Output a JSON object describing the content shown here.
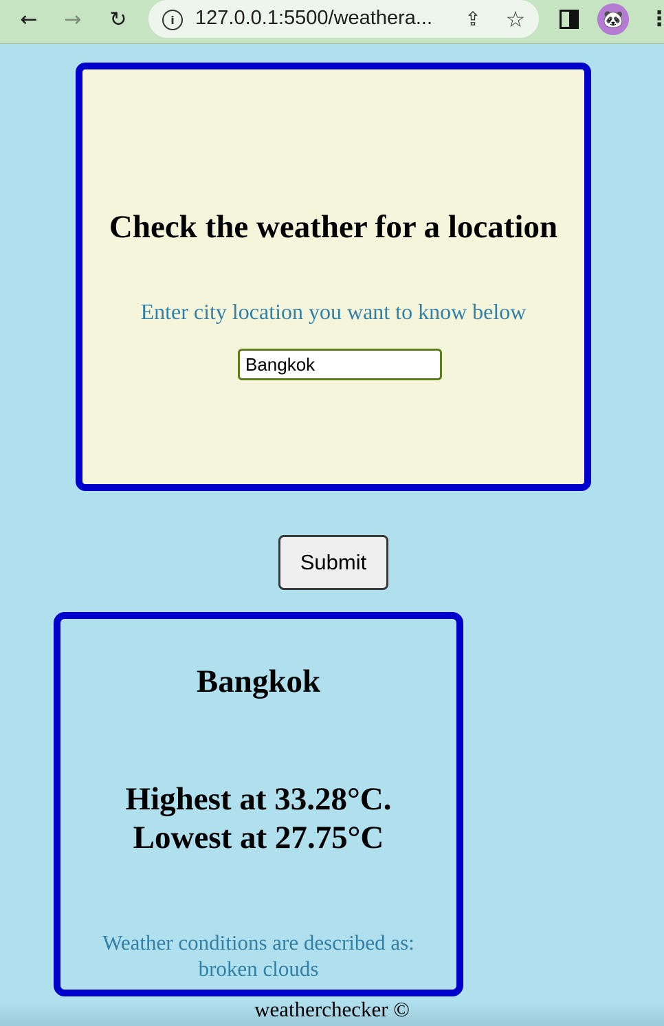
{
  "browser": {
    "url": "127.0.0.1:5500/weathera...",
    "icons": [
      "back-arrow-icon",
      "forward-arrow-icon",
      "reload-icon",
      "info-icon",
      "share-icon",
      "star-icon",
      "side-panel-icon",
      "profile-avatar",
      "more-menu-icon"
    ]
  },
  "search": {
    "title": "Check the weather for a location",
    "subtitle": "Enter city location you want to know below",
    "input_value": "Bangkok",
    "submit_label": "Submit"
  },
  "result": {
    "city": "Bangkok",
    "highest": "Highest at 33.28°C.",
    "lowest": "Lowest at 27.75°C",
    "desc_line1": "Weather conditions are described as:",
    "desc_line2": "broken clouds"
  },
  "footer": {
    "text": "weatherchecker ©"
  },
  "colors": {
    "page_background": "#b0dfed",
    "card_border": "#0000cd",
    "search_card_background": "#f5f5dc",
    "accent_text": "#3080a8"
  }
}
